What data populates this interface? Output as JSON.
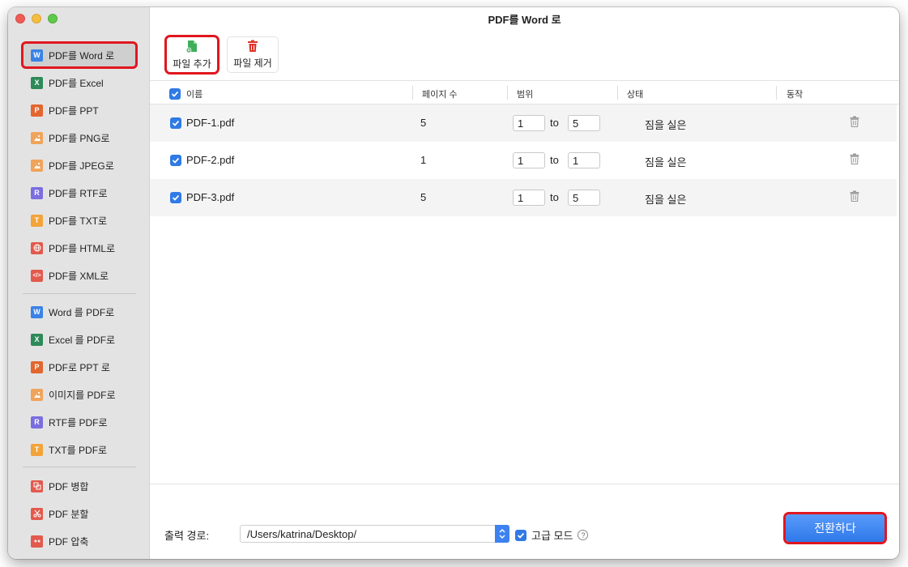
{
  "window": {
    "title": "PDF를 Word 로"
  },
  "sidebar": {
    "groups": [
      [
        {
          "label": "PDF를 Word 로",
          "icon": "W",
          "color": "#3a82e6",
          "active": true
        },
        {
          "label": "PDF를 Excel",
          "icon": "X",
          "color": "#2e8a58"
        },
        {
          "label": "PDF를 PPT",
          "icon": "P",
          "color": "#e2662e"
        },
        {
          "label": "PDF를 PNG로",
          "icon": "img",
          "color": "#f0a45b"
        },
        {
          "label": "PDF를 JPEG로",
          "icon": "img",
          "color": "#f0a45b"
        },
        {
          "label": "PDF를 RTF로",
          "icon": "R",
          "color": "#7a6ee0"
        },
        {
          "label": "PDF를 TXT로",
          "icon": "T",
          "color": "#f2a33a"
        },
        {
          "label": "PDF를 HTML로",
          "icon": "globe",
          "color": "#e25a4d"
        },
        {
          "label": "PDF를 XML로",
          "icon": "</>",
          "color": "#e25a4d"
        }
      ],
      [
        {
          "label": "Word 를 PDF로",
          "icon": "W",
          "color": "#3a82e6"
        },
        {
          "label": "Excel 를 PDF로",
          "icon": "X",
          "color": "#2e8a58"
        },
        {
          "label": "PDF로 PPT 로",
          "icon": "P",
          "color": "#e2662e"
        },
        {
          "label": "이미지를 PDF로",
          "icon": "img",
          "color": "#f0a45b"
        },
        {
          "label": "RTF를 PDF로",
          "icon": "R",
          "color": "#7a6ee0"
        },
        {
          "label": "TXT를 PDF로",
          "icon": "T",
          "color": "#f2a33a"
        }
      ],
      [
        {
          "label": "PDF 병합",
          "icon": "merge",
          "color": "#e25a4d"
        },
        {
          "label": "PDF 분할",
          "icon": "split",
          "color": "#e25a4d"
        },
        {
          "label": "PDF 압축",
          "icon": "compress",
          "color": "#e25a4d"
        }
      ]
    ]
  },
  "toolbar": {
    "add_label": "파일 추가",
    "remove_label": "파일 제거"
  },
  "table": {
    "headers": {
      "name": "이름",
      "pages": "페이지 수",
      "range": "범위",
      "status": "상태",
      "action": "동작"
    },
    "rows": [
      {
        "name": "PDF-1.pdf",
        "pages": "5",
        "from": "1",
        "to_word": "to",
        "to": "5",
        "status": "짐을 실은"
      },
      {
        "name": "PDF-2.pdf",
        "pages": "1",
        "from": "1",
        "to_word": "to",
        "to": "1",
        "status": "짐을 실은"
      },
      {
        "name": "PDF-3.pdf",
        "pages": "5",
        "from": "1",
        "to_word": "to",
        "to": "5",
        "status": "짐을 실은"
      }
    ]
  },
  "footer": {
    "output_label": "출력 경로:",
    "output_path": "/Users/katrina/Desktop/",
    "advanced_label": "고급 모드",
    "help_glyph": "?",
    "convert_label": "전환하다"
  }
}
